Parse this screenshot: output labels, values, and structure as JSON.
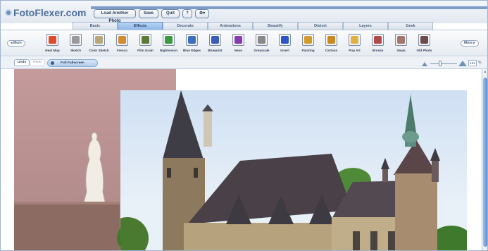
{
  "app": {
    "logo_text": "FotoFlexer.com",
    "brand_color": "#4d6f9c"
  },
  "top_buttons": {
    "load_another": "Load Another Photo",
    "save": "Save",
    "quit": "Quit",
    "help": "?",
    "settings": "⚙▾"
  },
  "tabs": [
    {
      "label": "Basic"
    },
    {
      "label": "Effects",
      "active": true
    },
    {
      "label": "Decorate"
    },
    {
      "label": "Animations"
    },
    {
      "label": "Beautify"
    },
    {
      "label": "Distort"
    },
    {
      "label": "Layers"
    },
    {
      "label": "Geek"
    }
  ],
  "strip": {
    "prev_label": "◂ More",
    "next_label": "More ▸",
    "effects": [
      {
        "label": "Heat Map",
        "color": "#e04a2a"
      },
      {
        "label": "Sketch",
        "color": "#9a9a9a"
      },
      {
        "label": "Color Sketch",
        "color": "#b9a77a"
      },
      {
        "label": "Fresco",
        "color": "#d48a2e"
      },
      {
        "label": "Film Grain",
        "color": "#5a7a3a"
      },
      {
        "label": "Nightvision",
        "color": "#3c9a3c"
      },
      {
        "label": "Blue Edges",
        "color": "#3a6fc0"
      },
      {
        "label": "Blueprint",
        "color": "#3b5bb6"
      },
      {
        "label": "Neon",
        "color": "#8a3ab0"
      },
      {
        "label": "Greyscale",
        "color": "#888888"
      },
      {
        "label": "Invert",
        "color": "#2c56c8"
      },
      {
        "label": "Painting",
        "color": "#d39b2c"
      },
      {
        "label": "Cartoon",
        "color": "#c98a1f"
      },
      {
        "label": "Pop Art",
        "color": "#e0b040"
      },
      {
        "label": "Bronze",
        "color": "#b04a4a"
      },
      {
        "label": "Sepia",
        "color": "#a4756a"
      },
      {
        "label": "Old Photo",
        "color": "#6b4a4a"
      }
    ]
  },
  "toolbar": {
    "undo": "Undo",
    "redo": "Redo",
    "full_fullscreen": "Full Fullscreen",
    "zoom_value": "124",
    "zoom_unit": "%"
  }
}
